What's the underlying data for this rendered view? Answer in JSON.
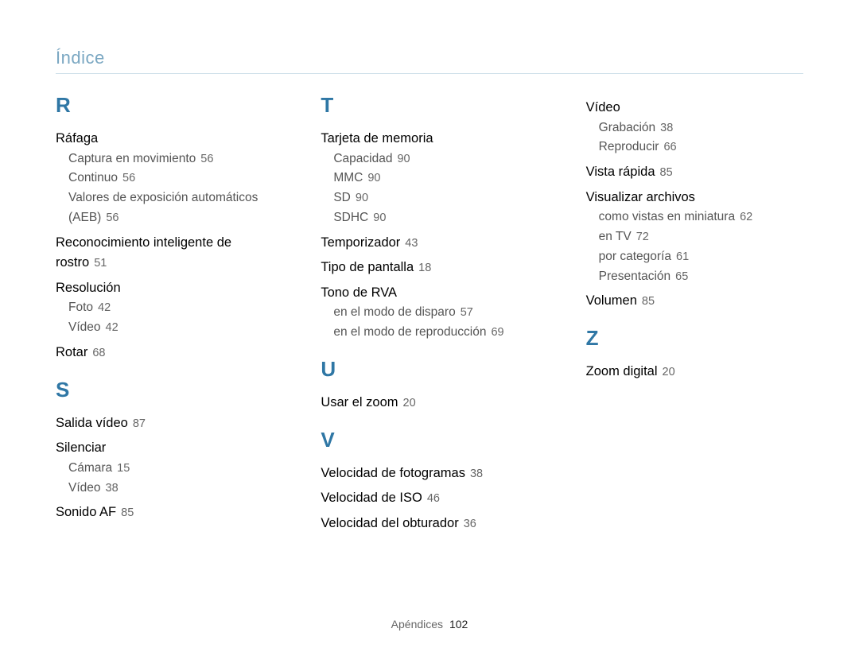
{
  "running_head": "Índice",
  "footer": {
    "section": "Apéndices",
    "page": "102"
  },
  "columns": [
    {
      "groups": [
        {
          "letter": "R",
          "items": [
            {
              "term": "Ráfaga",
              "subs": [
                {
                  "label": "Captura en movimiento",
                  "page": "56"
                },
                {
                  "label": "Continuo",
                  "page": "56"
                },
                {
                  "label": "Valores de exposición automáticos (AEB)",
                  "page": "56"
                }
              ]
            },
            {
              "term": "Reconocimiento inteligente de rostro",
              "page": "51"
            },
            {
              "term": "Resolución",
              "subs": [
                {
                  "label": "Foto",
                  "page": "42"
                },
                {
                  "label": "Vídeo",
                  "page": "42"
                }
              ]
            },
            {
              "term": "Rotar",
              "page": "68"
            }
          ]
        },
        {
          "letter": "S",
          "items": [
            {
              "term": "Salida vídeo",
              "page": "87"
            },
            {
              "term": "Silenciar",
              "subs": [
                {
                  "label": "Cámara",
                  "page": "15"
                },
                {
                  "label": "Vídeo",
                  "page": "38"
                }
              ]
            },
            {
              "term": "Sonido AF",
              "page": "85"
            }
          ]
        }
      ]
    },
    {
      "groups": [
        {
          "letter": "T",
          "items": [
            {
              "term": "Tarjeta de memoria",
              "subs": [
                {
                  "label": "Capacidad",
                  "page": "90"
                },
                {
                  "label": "MMC",
                  "page": "90"
                },
                {
                  "label": "SD",
                  "page": "90"
                },
                {
                  "label": "SDHC",
                  "page": "90"
                }
              ]
            },
            {
              "term": "Temporizador",
              "page": "43"
            },
            {
              "term": "Tipo de pantalla",
              "page": "18"
            },
            {
              "term": "Tono de RVA",
              "subs": [
                {
                  "label": "en el modo de disparo",
                  "page": "57"
                },
                {
                  "label": "en el modo de reproducción",
                  "page": "69"
                }
              ]
            }
          ]
        },
        {
          "letter": "U",
          "items": [
            {
              "term": "Usar el zoom",
              "page": "20"
            }
          ]
        },
        {
          "letter": "V",
          "items": [
            {
              "term": "Velocidad de fotogramas",
              "page": "38"
            },
            {
              "term": "Velocidad de ISO",
              "page": "46"
            },
            {
              "term": "Velocidad del obturador",
              "page": "36"
            }
          ]
        }
      ]
    },
    {
      "groups": [
        {
          "letter": "",
          "items": [
            {
              "term": "Vídeo",
              "subs": [
                {
                  "label": "Grabación",
                  "page": "38"
                },
                {
                  "label": "Reproducir",
                  "page": "66"
                }
              ]
            },
            {
              "term": "Vista rápida",
              "page": "85"
            },
            {
              "term": "Visualizar archivos",
              "subs": [
                {
                  "label": "como vistas en miniatura",
                  "page": "62"
                },
                {
                  "label": "en TV",
                  "page": "72"
                },
                {
                  "label": "por categoría",
                  "page": "61"
                },
                {
                  "label": "Presentación",
                  "page": "65"
                }
              ]
            },
            {
              "term": "Volumen",
              "page": "85"
            }
          ]
        },
        {
          "letter": "Z",
          "items": [
            {
              "term": "Zoom digital",
              "page": "20"
            }
          ]
        }
      ]
    }
  ]
}
